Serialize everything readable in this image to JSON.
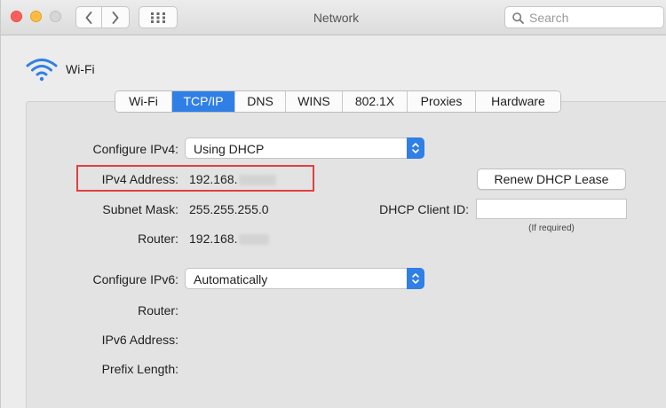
{
  "window": {
    "title": "Network",
    "search_placeholder": "Search"
  },
  "header": {
    "service_name": "Wi-Fi"
  },
  "tabs": [
    {
      "label": "Wi-Fi",
      "active": false
    },
    {
      "label": "TCP/IP",
      "active": true
    },
    {
      "label": "DNS",
      "active": false
    },
    {
      "label": "WINS",
      "active": false
    },
    {
      "label": "802.1X",
      "active": false
    },
    {
      "label": "Proxies",
      "active": false
    },
    {
      "label": "Hardware",
      "active": false
    }
  ],
  "ipv4": {
    "configure_label": "Configure IPv4:",
    "configure_value": "Using DHCP",
    "address_label": "IPv4 Address:",
    "address_value": "192.168.",
    "subnet_label": "Subnet Mask:",
    "subnet_value": "255.255.255.0",
    "router_label": "Router:",
    "router_value": "192.168."
  },
  "dhcp": {
    "renew_button": "Renew DHCP Lease",
    "client_id_label": "DHCP Client ID:",
    "client_id_value": "",
    "client_id_hint": "(If required)"
  },
  "ipv6": {
    "configure_label": "Configure IPv6:",
    "configure_value": "Automatically",
    "router_label": "Router:",
    "address_label": "IPv6 Address:",
    "prefix_label": "Prefix Length:"
  },
  "colors": {
    "accent": "#2f7fe6",
    "highlight_border": "#e04040",
    "close": "#fc605c",
    "minimize": "#fdbc40"
  }
}
